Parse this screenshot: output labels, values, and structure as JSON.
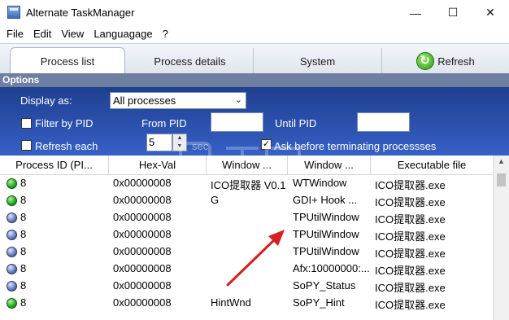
{
  "window": {
    "title": "Alternate TaskManager",
    "minimize": "—",
    "maximize": "☐",
    "close": "✕"
  },
  "menu": [
    "File",
    "Edit",
    "View",
    "Languagage",
    "?"
  ],
  "tabs": {
    "process_list": "Process list",
    "process_details": "Process details",
    "system": "System",
    "refresh": "Refresh"
  },
  "options": {
    "header": "Options",
    "display_as_label": "Display as:",
    "display_as_value": "All processes",
    "filter_by_pid": "Filter by PID",
    "from_pid": "From PID",
    "until_pid": "Until PID",
    "refresh_each": "Refresh each",
    "refresh_value": "5",
    "sec": "sec",
    "ask_before_terminating": "Ask before terminating processses"
  },
  "grid": {
    "headers": [
      "Process ID (PI...",
      "Hex-Val",
      "Window ...",
      "Window ...",
      "Executable file"
    ],
    "rows": [
      {
        "status": "green",
        "pid": "8",
        "hex": "0x00000008",
        "win1": "ICO提取器 V0.1...",
        "win2": "WTWindow",
        "exe": "ICO提取器.exe"
      },
      {
        "status": "green",
        "pid": "8",
        "hex": "0x00000008",
        "win1": "G",
        "win2": "GDI+ Hook ...",
        "exe": "ICO提取器.exe"
      },
      {
        "status": "blue",
        "pid": "8",
        "hex": "0x00000008",
        "win1": "",
        "win2": "TPUtilWindow",
        "exe": "ICO提取器.exe"
      },
      {
        "status": "blue",
        "pid": "8",
        "hex": "0x00000008",
        "win1": "",
        "win2": "TPUtilWindow",
        "exe": "ICO提取器.exe"
      },
      {
        "status": "blue",
        "pid": "8",
        "hex": "0x00000008",
        "win1": "",
        "win2": "TPUtilWindow",
        "exe": "ICO提取器.exe"
      },
      {
        "status": "blue",
        "pid": "8",
        "hex": "0x00000008",
        "win1": "",
        "win2": "Afx:10000000:...",
        "exe": "ICO提取器.exe"
      },
      {
        "status": "blue",
        "pid": "8",
        "hex": "0x00000008",
        "win1": "",
        "win2": "SoPY_Status",
        "exe": "ICO提取器.exe"
      },
      {
        "status": "green",
        "pid": "8",
        "hex": "0x00000008",
        "win1": "HintWnd",
        "win2": "SoPY_Hint",
        "exe": "ICO提取器.exe"
      }
    ]
  },
  "colors": {
    "options_panel": "#2d55b5",
    "annotation_arrow": "#d42020"
  }
}
